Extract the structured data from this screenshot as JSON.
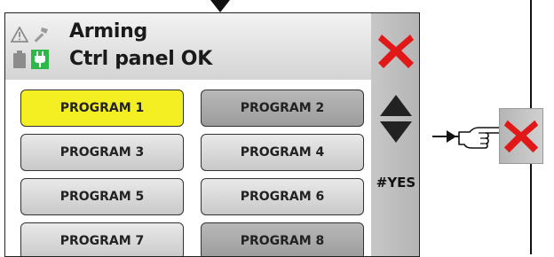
{
  "header": {
    "title": "Arming",
    "subtitle": "Ctrl panel OK",
    "status_icons": [
      "warning-icon",
      "hammer-icon",
      "battery-icon",
      "power-plug-icon"
    ]
  },
  "programs": [
    {
      "label": "PROGRAM 1",
      "state": "selected"
    },
    {
      "label": "PROGRAM 2",
      "state": "dark"
    },
    {
      "label": "PROGRAM 3",
      "state": "light"
    },
    {
      "label": "PROGRAM 4",
      "state": "light"
    },
    {
      "label": "PROGRAM 5",
      "state": "light"
    },
    {
      "label": "PROGRAM 6",
      "state": "light"
    },
    {
      "label": "PROGRAM 7",
      "state": "light"
    },
    {
      "label": "PROGRAM 8",
      "state": "dark"
    }
  ],
  "sidebar": {
    "close_icon": "close-x-icon",
    "up_icon": "arrow-up-icon",
    "down_icon": "arrow-down-icon",
    "yes_label": "#YES"
  },
  "callout": {
    "pointer_icon": "pointing-hand-icon",
    "close_icon": "close-x-icon"
  },
  "colors": {
    "selected": "#f4ef22",
    "close_red": "#e01818",
    "plug_green": "#2db84a"
  }
}
